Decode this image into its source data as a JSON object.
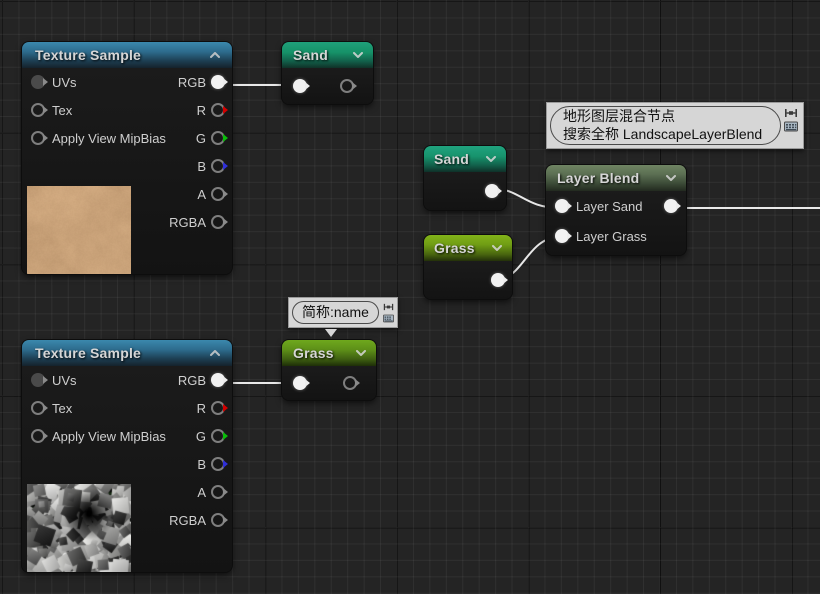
{
  "app": {
    "editor": "Unreal Engine Material Graph",
    "background_color": "#242424",
    "grid_line_color": "#3a3a3a"
  },
  "nodes": [
    {
      "id": "texture-sample-sand",
      "title": "Texture Sample",
      "header_color": "#2d6b8c",
      "collapse_icon": "chevron-up-icon",
      "inputs": [
        "UVs",
        "Tex",
        "Apply View MipBias"
      ],
      "outputs": [
        "RGB",
        "R",
        "G",
        "B",
        "A",
        "RGBA"
      ],
      "thumbnail": "sand-texture"
    },
    {
      "id": "texture-sample-grass",
      "title": "Texture Sample",
      "header_color": "#2d6b8c",
      "collapse_icon": "chevron-up-icon",
      "inputs": [
        "UVs",
        "Tex",
        "Apply View MipBias"
      ],
      "outputs": [
        "RGB",
        "R",
        "G",
        "B",
        "A",
        "RGBA"
      ],
      "thumbnail": "rock-texture"
    },
    {
      "id": "sand-top",
      "title": "Sand",
      "header_color": "#169268",
      "collapse_icon": "chevron-down-icon"
    },
    {
      "id": "sand-mid",
      "title": "Sand",
      "header_color": "#17936c",
      "collapse_icon": "chevron-down-icon"
    },
    {
      "id": "grass-mid",
      "title": "Grass",
      "header_color": "#6f9c14",
      "collapse_icon": "chevron-down-icon"
    },
    {
      "id": "grass-bottom",
      "title": "Grass",
      "header_color": "#5d8f18",
      "collapse_icon": "chevron-down-icon"
    },
    {
      "id": "layer-blend",
      "title": "Layer Blend",
      "header_color": "#5b6f52",
      "collapse_icon": "chevron-down-icon",
      "inputs": [
        "Layer Sand",
        "Layer Grass"
      ]
    }
  ],
  "callouts": [
    {
      "id": "landscape-layer-blend-note",
      "line1": "地形图层混合节点",
      "line2": "搜索全称 LandscapeLayerBlend",
      "icons": [
        "move-handle-icon",
        "keyboard-icon"
      ]
    },
    {
      "id": "name-note",
      "line1": "简称:name",
      "icons": [
        "move-handle-icon",
        "keyboard-icon"
      ]
    }
  ],
  "labels": {
    "texture_sample": "Texture Sample",
    "uvs": "UVs",
    "tex": "Tex",
    "apply_view_mipbias": "Apply View MipBias",
    "rgb": "RGB",
    "r": "R",
    "g": "G",
    "b": "B",
    "a": "A",
    "rgba": "RGBA",
    "sand": "Sand",
    "grass": "Grass",
    "layer_blend": "Layer Blend",
    "layer_sand": "Layer Sand",
    "layer_grass": "Layer Grass"
  },
  "pin_colors": {
    "rgb": "#ededed",
    "r": "#d40000",
    "g": "#0bbd0b",
    "b": "#2020cc",
    "a": "#8a8a8a",
    "rgba": "#8a8a8a",
    "wire": "#e8e8e8"
  }
}
